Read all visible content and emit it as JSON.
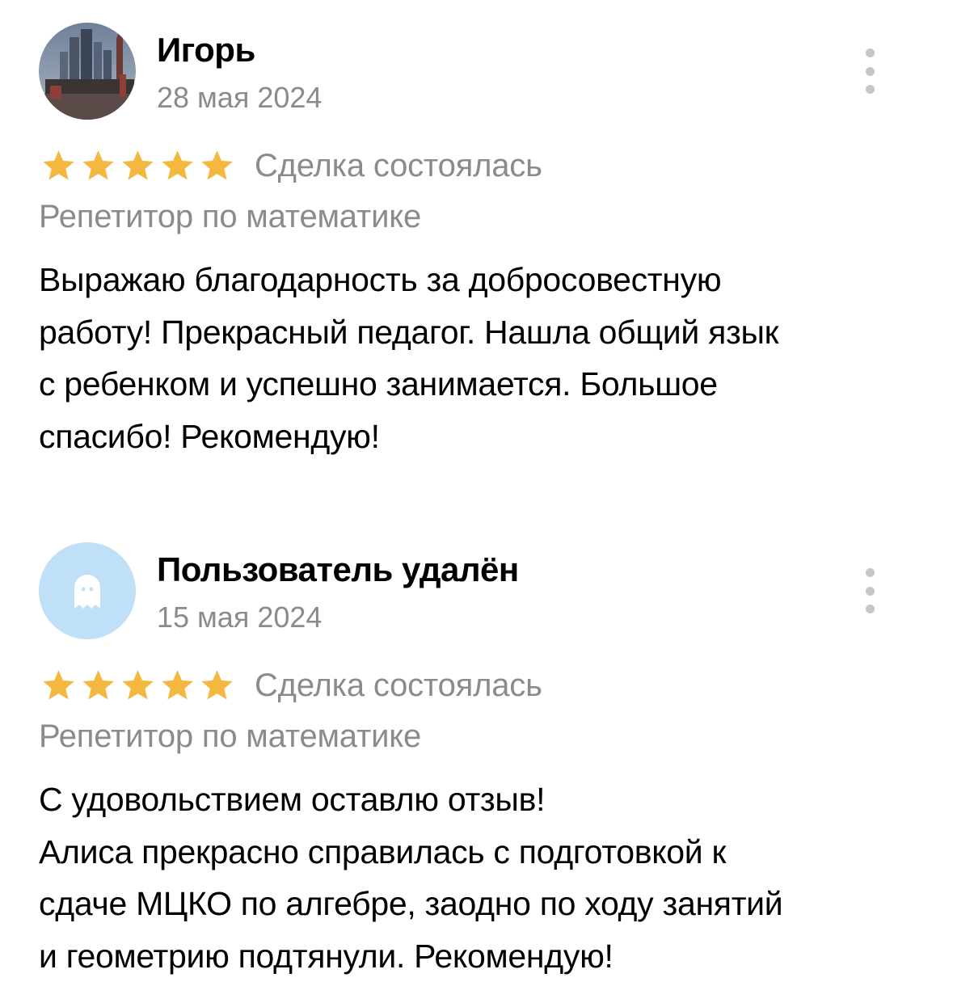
{
  "reviews": [
    {
      "author": "Игорь",
      "date": "28 мая 2024",
      "avatar_icon": "city-skyline-photo",
      "rating": 5,
      "deal_status": "Сделка состоялась",
      "service": "Репетитор по математике",
      "text": "Выражаю благодарность за добросовестную\nработу! Прекрасный педагог. Нашла общий язык\nс ребенком и успешно занимается. Большое\nспасибо! Рекомендую!"
    },
    {
      "author": "Пользователь удалён",
      "date": "15 мая 2024",
      "avatar_icon": "ghost-icon",
      "rating": 5,
      "deal_status": "Сделка состоялась",
      "service": "Репетитор по математике",
      "text": "С удовольствием оставлю отзыв!\nАлиса прекрасно справилась с подготовкой к\nсдаче МЦКО по алгебре, заодно по ходу занятий\nи геометрию подтянули. Рекомендую!"
    }
  ],
  "colors": {
    "star": "#F4B740",
    "secondary_text": "#8B8B8B",
    "deleted_avatar_bg": "#BFE0F7",
    "more_dots": "#C6C6C6"
  }
}
